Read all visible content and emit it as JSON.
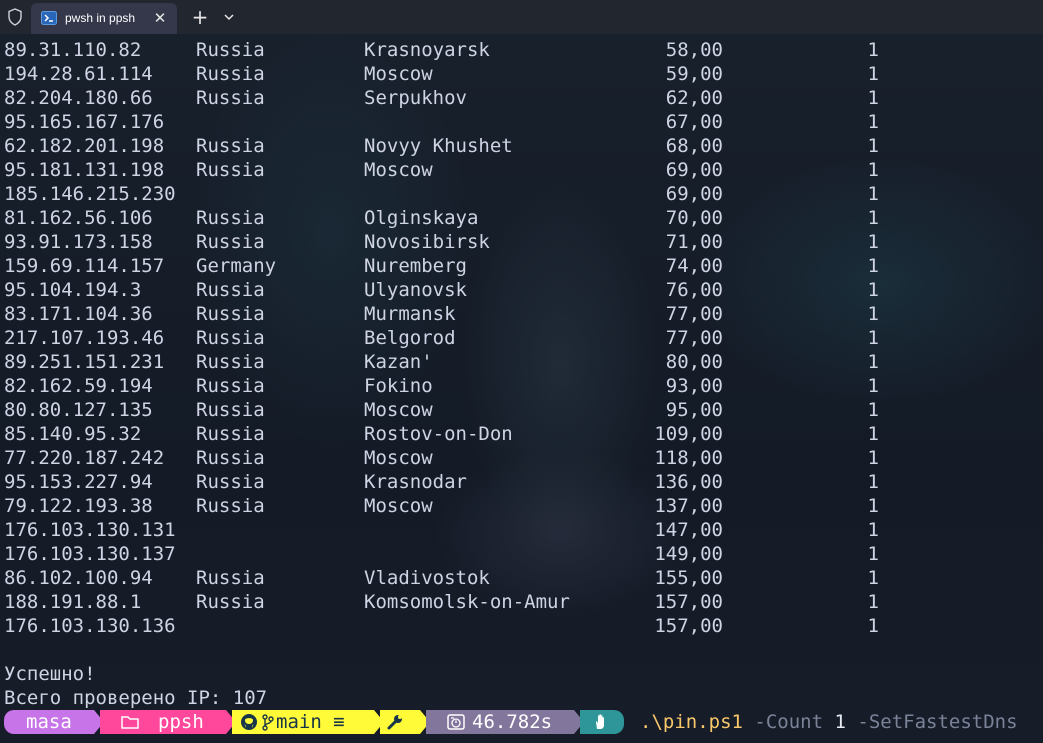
{
  "window": {
    "tab_title": "pwsh in ppsh",
    "tab_icon": "powershell-icon",
    "shield_icon": "shield-icon",
    "new_tab_label": "+",
    "close_label": "✕"
  },
  "rows": [
    {
      "ip": "89.31.110.82",
      "country": "Russia",
      "city": "Krasnoyarsk",
      "ping": "58,00",
      "count": "1"
    },
    {
      "ip": "194.28.61.114",
      "country": "Russia",
      "city": "Moscow",
      "ping": "59,00",
      "count": "1"
    },
    {
      "ip": "82.204.180.66",
      "country": "Russia",
      "city": "Serpukhov",
      "ping": "62,00",
      "count": "1"
    },
    {
      "ip": "95.165.167.176",
      "country": "",
      "city": "",
      "ping": "67,00",
      "count": "1"
    },
    {
      "ip": "62.182.201.198",
      "country": "Russia",
      "city": "Novyy Khushet",
      "ping": "68,00",
      "count": "1"
    },
    {
      "ip": "95.181.131.198",
      "country": "Russia",
      "city": "Moscow",
      "ping": "69,00",
      "count": "1"
    },
    {
      "ip": "185.146.215.230",
      "country": "",
      "city": "",
      "ping": "69,00",
      "count": "1"
    },
    {
      "ip": "81.162.56.106",
      "country": "Russia",
      "city": "Olginskaya",
      "ping": "70,00",
      "count": "1"
    },
    {
      "ip": "93.91.173.158",
      "country": "Russia",
      "city": "Novosibirsk",
      "ping": "71,00",
      "count": "1"
    },
    {
      "ip": "159.69.114.157",
      "country": "Germany",
      "city": "Nuremberg",
      "ping": "74,00",
      "count": "1"
    },
    {
      "ip": "95.104.194.3",
      "country": "Russia",
      "city": "Ulyanovsk",
      "ping": "76,00",
      "count": "1"
    },
    {
      "ip": "83.171.104.36",
      "country": "Russia",
      "city": "Murmansk",
      "ping": "77,00",
      "count": "1"
    },
    {
      "ip": "217.107.193.46",
      "country": "Russia",
      "city": "Belgorod",
      "ping": "77,00",
      "count": "1"
    },
    {
      "ip": "89.251.151.231",
      "country": "Russia",
      "city": "Kazan'",
      "ping": "80,00",
      "count": "1"
    },
    {
      "ip": "82.162.59.194",
      "country": "Russia",
      "city": "Fokino",
      "ping": "93,00",
      "count": "1"
    },
    {
      "ip": "80.80.127.135",
      "country": "Russia",
      "city": "Moscow",
      "ping": "95,00",
      "count": "1"
    },
    {
      "ip": "85.140.95.32",
      "country": "Russia",
      "city": "Rostov-on-Don",
      "ping": "109,00",
      "count": "1"
    },
    {
      "ip": "77.220.187.242",
      "country": "Russia",
      "city": "Moscow",
      "ping": "118,00",
      "count": "1"
    },
    {
      "ip": "95.153.227.94",
      "country": "Russia",
      "city": "Krasnodar",
      "ping": "136,00",
      "count": "1"
    },
    {
      "ip": "79.122.193.38",
      "country": "Russia",
      "city": "Moscow",
      "ping": "137,00",
      "count": "1"
    },
    {
      "ip": "176.103.130.131",
      "country": "",
      "city": "",
      "ping": "147,00",
      "count": "1"
    },
    {
      "ip": "176.103.130.137",
      "country": "",
      "city": "",
      "ping": "149,00",
      "count": "1"
    },
    {
      "ip": "86.102.100.94",
      "country": "Russia",
      "city": "Vladivostok",
      "ping": "155,00",
      "count": "1"
    },
    {
      "ip": "188.191.88.1",
      "country": "Russia",
      "city": "Komsomolsk-on-Amur",
      "ping": "157,00",
      "count": "1"
    },
    {
      "ip": "176.103.130.136",
      "country": "",
      "city": "",
      "ping": "157,00",
      "count": "1"
    }
  ],
  "messages": {
    "success": "Успешно!",
    "total": "Всего проверено IP: 107"
  },
  "prompt": {
    "user": "masa",
    "folder_icon": "folder-icon",
    "path": "ppsh",
    "git_icon": "github-icon",
    "branch": "main ≡",
    "tool_icon": "wrench-icon",
    "timer_icon": "stopwatch-icon",
    "duration": "46.782s",
    "hand_icon": "hand-icon",
    "colors": {
      "user": "#c774e8",
      "path": "#ff479c",
      "git": "#fffb38",
      "time": "#83769c",
      "status": "#2e9599"
    }
  },
  "command": {
    "name": ".\\pin.ps1",
    "param1": "-Count",
    "value1": "1",
    "param2": "-SetFastestDns"
  }
}
